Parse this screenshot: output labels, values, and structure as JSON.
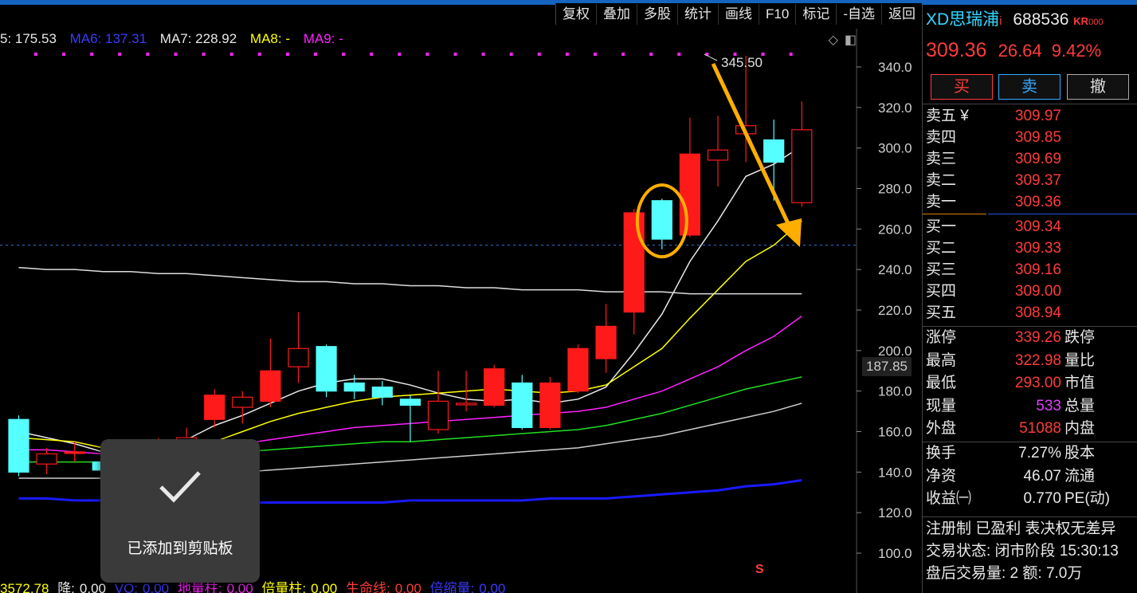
{
  "toolbar": {
    "items": [
      "复权",
      "叠加",
      "多股",
      "统计",
      "画线",
      "F10",
      "标记",
      "-自选",
      "返回"
    ]
  },
  "ma_legend": {
    "ma5": "5: 175.53",
    "ma6": "MA6: 137.31",
    "ma7": "MA7: 228.92",
    "ma8": "MA8: -",
    "ma9": "MA9: -"
  },
  "price_axis": {
    "labels": [
      "340.0",
      "320.0",
      "300.0",
      "280.0",
      "260.0",
      "240.0",
      "220.0",
      "200.0",
      "180.0",
      "160.0",
      "140.0",
      "120.0",
      "100.0"
    ],
    "cursor_value": "187.85"
  },
  "high_annotation": "345.50",
  "s_marker": "S",
  "toast": {
    "message": "已添加到剪贴板"
  },
  "indicator_legend": {
    "vol": "3572.78",
    "jiang_label": "降:",
    "jiang": "0.00",
    "vo_label": "VO:",
    "vo": "0.00",
    "dl_label": "地量柱:",
    "dl": "0.00",
    "bl_label": "倍量柱:",
    "bl": "0.00",
    "sm_label": "生命线:",
    "sm": "0.00",
    "bs_label": "倍缩量:",
    "bs": "0.00"
  },
  "stock": {
    "name": "XD思瑞浦",
    "info_mark": "i",
    "code": "688536",
    "kr_tag": "KR",
    "kr_num": "000",
    "price": "309.36",
    "change": "26.64",
    "change_pct": "9.42%"
  },
  "trade_buttons": {
    "buy": "买",
    "sell": "卖",
    "cancel": "撤"
  },
  "order_book": {
    "asks": [
      {
        "label": "卖五 ¥",
        "price": "309.97"
      },
      {
        "label": "卖四",
        "price": "309.85"
      },
      {
        "label": "卖三",
        "price": "309.69"
      },
      {
        "label": "卖二",
        "price": "309.37"
      },
      {
        "label": "卖一",
        "price": "309.36"
      }
    ],
    "bids": [
      {
        "label": "买一",
        "price": "309.34"
      },
      {
        "label": "买二",
        "price": "309.33"
      },
      {
        "label": "买三",
        "price": "309.16"
      },
      {
        "label": "买四",
        "price": "309.00"
      },
      {
        "label": "买五",
        "price": "308.94"
      }
    ]
  },
  "stats": [
    {
      "label": "涨停",
      "value": "339.26",
      "label2": "跌停"
    },
    {
      "label": "最高",
      "value": "322.98",
      "label2": "量比"
    },
    {
      "label": "最低",
      "value": "293.00",
      "label2": "市值"
    },
    {
      "label": "现量",
      "value": "533",
      "label2": "总量"
    },
    {
      "label": "外盘",
      "value": "51088",
      "label2": "内盘"
    }
  ],
  "stats2": [
    {
      "label": "换手",
      "value": "7.27%",
      "label2": "股本"
    },
    {
      "label": "净资",
      "value": "46.07",
      "label2": "流通"
    },
    {
      "label": "收益㈠",
      "value": "0.770",
      "label2": "PE(动)"
    }
  ],
  "footer": {
    "line1": "注册制 已盈利 表决权无差异",
    "line2": "交易状态: 闭市阶段 15:30:13",
    "line3": "盘后交易量: 2  额: 7.0万"
  },
  "colors": {
    "up": "#ff1a1a",
    "down": "#55ffff",
    "ma_yellow": "#ffff00",
    "ma_magenta": "#ff22ff",
    "ma_green": "#22dd22",
    "ma_blue": "#1a1aff",
    "annot": "#ffbb00"
  },
  "chart_data": {
    "type": "candlestick",
    "candles": [
      {
        "open": 166,
        "close": 140,
        "high": 168,
        "low": 138
      },
      {
        "open": 144,
        "close": 149,
        "high": 152,
        "low": 139
      },
      {
        "open": 150,
        "close": 150,
        "high": 155,
        "low": 145
      },
      {
        "open": 145,
        "close": 141,
        "high": 150,
        "low": 139
      },
      {
        "open": 145,
        "close": 150,
        "high": 156,
        "low": 142
      },
      {
        "open": 147,
        "close": 152,
        "high": 157,
        "low": 145
      },
      {
        "open": 155,
        "close": 157,
        "high": 162,
        "low": 146
      },
      {
        "open": 166,
        "close": 178,
        "high": 181,
        "low": 162
      },
      {
        "open": 172,
        "close": 177,
        "high": 180,
        "low": 164
      },
      {
        "open": 175,
        "close": 190,
        "high": 206,
        "low": 172
      },
      {
        "open": 192,
        "close": 201,
        "high": 219,
        "low": 184
      },
      {
        "open": 202,
        "close": 180,
        "high": 203,
        "low": 177
      },
      {
        "open": 184,
        "close": 180,
        "high": 188,
        "low": 176
      },
      {
        "open": 182,
        "close": 177,
        "high": 185,
        "low": 173
      },
      {
        "open": 176,
        "close": 173,
        "high": 178,
        "low": 155
      },
      {
        "open": 161,
        "close": 175,
        "high": 190,
        "low": 159
      },
      {
        "open": 174,
        "close": 174,
        "high": 190,
        "low": 170
      },
      {
        "open": 173,
        "close": 191,
        "high": 193,
        "low": 172
      },
      {
        "open": 184,
        "close": 162,
        "high": 188,
        "low": 161
      },
      {
        "open": 162,
        "close": 184,
        "high": 187,
        "low": 161
      },
      {
        "open": 180,
        "close": 201,
        "high": 203,
        "low": 179
      },
      {
        "open": 196,
        "close": 212,
        "high": 223,
        "low": 189
      },
      {
        "open": 219,
        "close": 268,
        "high": 270,
        "low": 208
      },
      {
        "open": 274,
        "close": 255,
        "high": 275,
        "low": 250
      },
      {
        "open": 257,
        "close": 297,
        "high": 315,
        "low": 256
      },
      {
        "open": 294,
        "close": 299,
        "high": 316,
        "low": 281
      },
      {
        "open": 307,
        "close": 311,
        "high": 345.5,
        "low": 293
      },
      {
        "open": 304,
        "close": 293,
        "high": 314,
        "low": 274
      },
      {
        "open": 273,
        "close": 309,
        "high": 323,
        "low": 271
      }
    ],
    "ma_lines": [
      {
        "name": "MA_white",
        "color": "#e8e8e8",
        "values": [
          160,
          157,
          154,
          150,
          147,
          150,
          156,
          163,
          168,
          174,
          180,
          184,
          186,
          186,
          183,
          179,
          176,
          175,
          176,
          174,
          176,
          182,
          199,
          218,
          244,
          264,
          286,
          292,
          301
        ]
      },
      {
        "name": "MA_yellow",
        "color": "#ffff00",
        "values": [
          157,
          156,
          155,
          152,
          150,
          151,
          152,
          155,
          160,
          165,
          169,
          172,
          175,
          177,
          178,
          179,
          180,
          181,
          180,
          179,
          180,
          183,
          192,
          201,
          216,
          230,
          244,
          252,
          264
        ]
      },
      {
        "name": "MA_magenta",
        "color": "#ff22ff",
        "values": [
          151,
          151,
          150,
          149,
          149,
          150,
          151,
          152,
          154,
          156,
          158,
          160,
          162,
          163,
          164,
          165,
          166,
          167,
          168,
          169,
          170,
          172,
          176,
          180,
          186,
          192,
          200,
          207,
          217
        ]
      },
      {
        "name": "MA_green",
        "color": "#22dd22",
        "values": [
          145,
          145,
          145,
          145,
          146,
          147,
          148,
          149,
          150,
          151,
          152,
          153,
          154,
          155,
          155,
          156,
          157,
          158,
          159,
          160,
          161,
          163,
          166,
          169,
          173,
          177,
          181,
          184,
          187
        ]
      },
      {
        "name": "MA_grey",
        "color": "#cccccc",
        "values": [
          137,
          137,
          137,
          137,
          138,
          138,
          139,
          139,
          140,
          141,
          142,
          143,
          144,
          145,
          146,
          147,
          148,
          149,
          150,
          151,
          152,
          154,
          156,
          158,
          161,
          164,
          167,
          170,
          174
        ]
      },
      {
        "name": "MA_blue",
        "color": "#1a1aff",
        "values": [
          127,
          127,
          126,
          126,
          126,
          126,
          126,
          125,
          125,
          125,
          125,
          125,
          125,
          125,
          126,
          126,
          126,
          126,
          126,
          127,
          127,
          127,
          128,
          129,
          130,
          131,
          133,
          134,
          136
        ]
      },
      {
        "name": "MA_flat",
        "color": "#dddddd",
        "values": [
          241,
          240,
          240,
          239,
          239,
          238,
          238,
          237,
          236,
          235,
          234,
          234,
          233,
          233,
          232,
          232,
          231,
          231,
          230,
          230,
          230,
          229,
          229,
          229,
          228,
          228,
          228,
          228,
          228
        ]
      }
    ],
    "ylim": [
      95,
      350
    ],
    "ref_line": 252
  }
}
